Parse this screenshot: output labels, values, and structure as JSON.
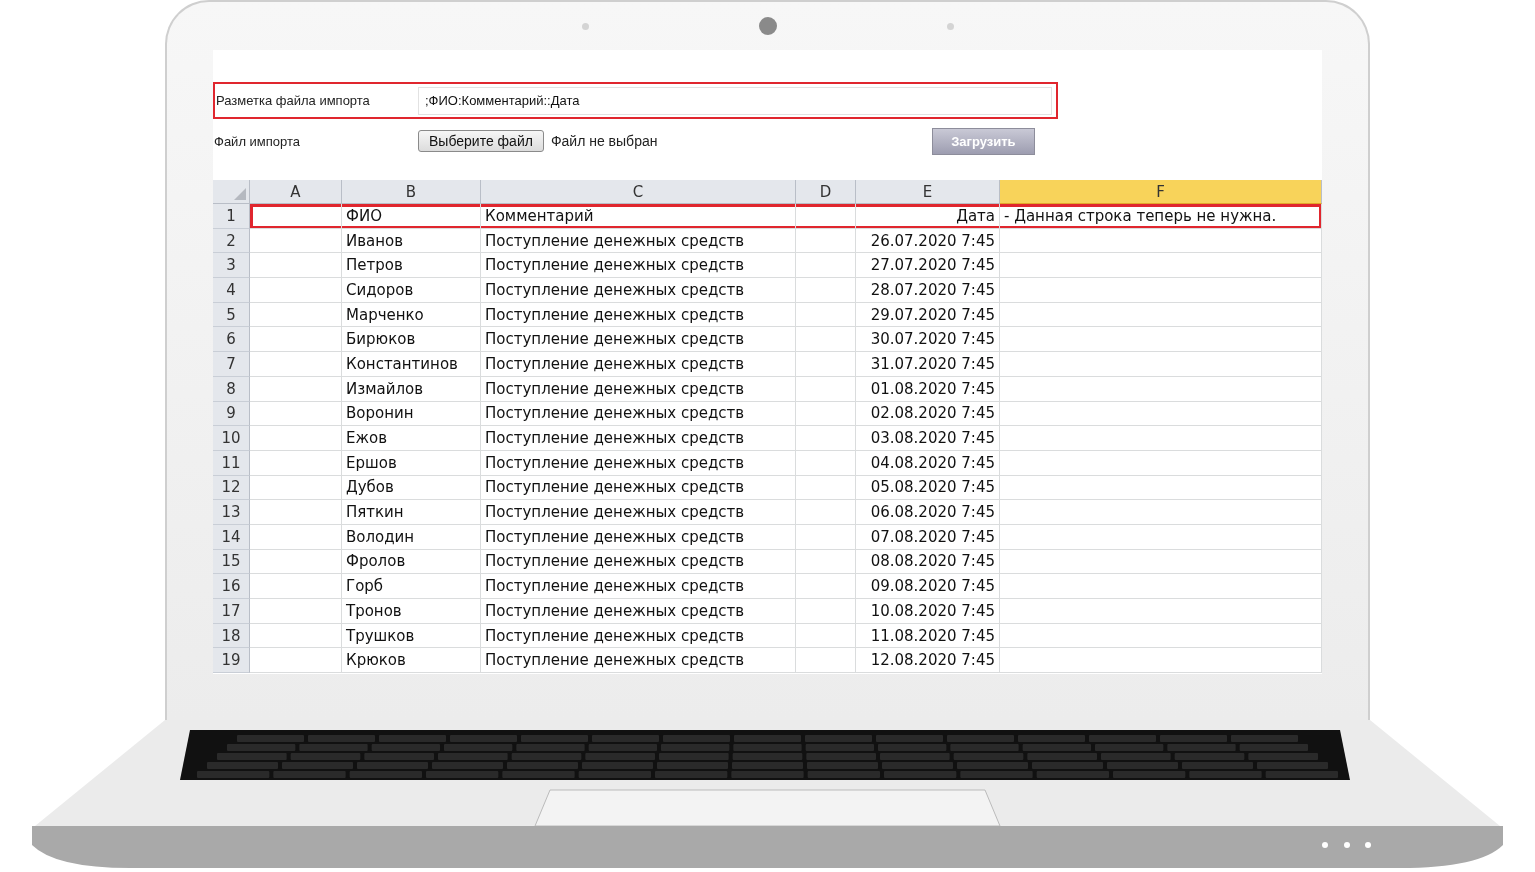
{
  "form": {
    "markup_label": "Разметка файла импорта",
    "markup_value": ";ФИО:Комментарий::Дата",
    "markup_highlighted": true,
    "file_label": "Файл импорта",
    "choose_button": "Выберите файл",
    "file_status": "Файл не выбран",
    "upload_button": "Загрузить"
  },
  "table": {
    "columns": [
      {
        "label": "A",
        "selected": false
      },
      {
        "label": "B",
        "selected": false
      },
      {
        "label": "C",
        "selected": false
      },
      {
        "label": "D",
        "selected": false
      },
      {
        "label": "E",
        "selected": false
      },
      {
        "label": "F",
        "selected": true
      }
    ],
    "rows": [
      {
        "number": "1",
        "highlighted": true,
        "cells": [
          "",
          "ФИО",
          "Комментарий",
          "",
          "Дата",
          "- Данная строка теперь не нужна."
        ]
      },
      {
        "number": "2",
        "highlighted": false,
        "cells": [
          "",
          "Иванов",
          "Поступление денежных средств",
          "",
          "26.07.2020 7:45",
          ""
        ]
      },
      {
        "number": "3",
        "highlighted": false,
        "cells": [
          "",
          "Петров",
          "Поступление денежных средств",
          "",
          "27.07.2020 7:45",
          ""
        ]
      },
      {
        "number": "4",
        "highlighted": false,
        "cells": [
          "",
          "Сидоров",
          "Поступление денежных средств",
          "",
          "28.07.2020 7:45",
          ""
        ]
      },
      {
        "number": "5",
        "highlighted": false,
        "cells": [
          "",
          "Марченко",
          "Поступление денежных средств",
          "",
          "29.07.2020 7:45",
          ""
        ]
      },
      {
        "number": "6",
        "highlighted": false,
        "cells": [
          "",
          "Бирюков",
          "Поступление денежных средств",
          "",
          "30.07.2020 7:45",
          ""
        ]
      },
      {
        "number": "7",
        "highlighted": false,
        "cells": [
          "",
          "Константинов",
          "Поступление денежных средств",
          "",
          "31.07.2020 7:45",
          ""
        ]
      },
      {
        "number": "8",
        "highlighted": false,
        "cells": [
          "",
          "Измайлов",
          "Поступление денежных средств",
          "",
          "01.08.2020 7:45",
          ""
        ]
      },
      {
        "number": "9",
        "highlighted": false,
        "cells": [
          "",
          "Воронин",
          "Поступление денежных средств",
          "",
          "02.08.2020 7:45",
          ""
        ]
      },
      {
        "number": "10",
        "highlighted": false,
        "cells": [
          "",
          "Ежов",
          "Поступление денежных средств",
          "",
          "03.08.2020 7:45",
          ""
        ]
      },
      {
        "number": "11",
        "highlighted": false,
        "cells": [
          "",
          "Ершов",
          "Поступление денежных средств",
          "",
          "04.08.2020 7:45",
          ""
        ]
      },
      {
        "number": "12",
        "highlighted": false,
        "cells": [
          "",
          "Дубов",
          "Поступление денежных средств",
          "",
          "05.08.2020 7:45",
          ""
        ]
      },
      {
        "number": "13",
        "highlighted": false,
        "cells": [
          "",
          "Пяткин",
          "Поступление денежных средств",
          "",
          "06.08.2020 7:45",
          ""
        ]
      },
      {
        "number": "14",
        "highlighted": false,
        "cells": [
          "",
          "Володин",
          "Поступление денежных средств",
          "",
          "07.08.2020 7:45",
          ""
        ]
      },
      {
        "number": "15",
        "highlighted": false,
        "cells": [
          "",
          "Фролов",
          "Поступление денежных средств",
          "",
          "08.08.2020 7:45",
          ""
        ]
      },
      {
        "number": "16",
        "highlighted": false,
        "cells": [
          "",
          "Горб",
          "Поступление денежных средств",
          "",
          "09.08.2020 7:45",
          ""
        ]
      },
      {
        "number": "17",
        "highlighted": false,
        "cells": [
          "",
          "Тронов",
          "Поступление денежных средств",
          "",
          "10.08.2020 7:45",
          ""
        ]
      },
      {
        "number": "18",
        "highlighted": false,
        "cells": [
          "",
          "Трушков",
          "Поступление денежных средств",
          "",
          "11.08.2020 7:45",
          ""
        ]
      },
      {
        "number": "19",
        "highlighted": false,
        "cells": [
          "",
          "Крюков",
          "Поступление денежных средств",
          "",
          "12.08.2020 7:45",
          ""
        ]
      }
    ]
  }
}
